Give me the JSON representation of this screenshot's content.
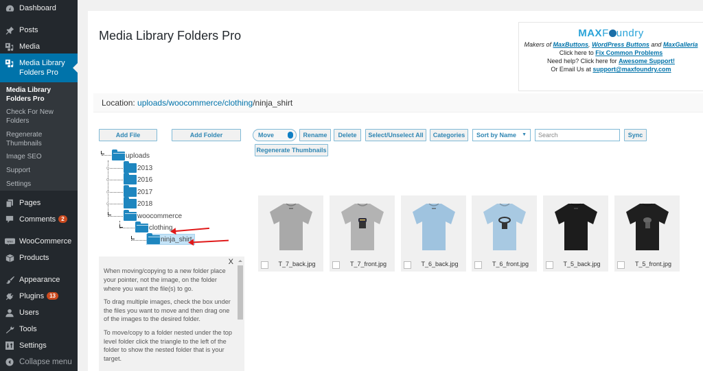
{
  "sidebar": {
    "items": [
      {
        "label": "Dashboard",
        "icon": "dashboard-icon"
      },
      {
        "label": "Posts",
        "icon": "pin-icon"
      },
      {
        "label": "Media",
        "icon": "media-icon"
      },
      {
        "label": "Media Library Folders Pro",
        "icon": "media-icon",
        "current": true
      },
      {
        "label": "Pages",
        "icon": "pages-icon"
      },
      {
        "label": "Comments",
        "icon": "comment-icon",
        "badge": "2"
      },
      {
        "label": "WooCommerce",
        "icon": "woo-icon"
      },
      {
        "label": "Products",
        "icon": "box-icon"
      },
      {
        "label": "Appearance",
        "icon": "brush-icon"
      },
      {
        "label": "Plugins",
        "icon": "plug-icon",
        "badge": "13"
      },
      {
        "label": "Users",
        "icon": "user-icon"
      },
      {
        "label": "Tools",
        "icon": "wrench-icon"
      },
      {
        "label": "Settings",
        "icon": "settings-icon"
      },
      {
        "label": "Collapse menu",
        "icon": "collapse-icon"
      }
    ],
    "submenu": [
      {
        "label": "Media Library Folders Pro",
        "current": true
      },
      {
        "label": "Check For New Folders"
      },
      {
        "label": "Regenerate Thumbnails"
      },
      {
        "label": "Image SEO"
      },
      {
        "label": "Support"
      },
      {
        "label": "Settings"
      }
    ]
  },
  "header": {
    "title": "Media Library Folders Pro"
  },
  "promo": {
    "logo_max": "MAX",
    "logo_f": "F",
    "logo_rest": "undry",
    "makers_prefix": "Makers of ",
    "link_maxbuttons": "MaxButtons",
    "comma": ", ",
    "link_wpbuttons": "WordPress Buttons",
    "and": " and ",
    "link_maxgalleria": "MaxGalleria",
    "fix_prefix": "Click here to ",
    "link_fix": "Fix Common Problems",
    "help_prefix": "Need help? Click here for ",
    "link_support": "Awesome Support!",
    "email_prefix": "Or Email Us at ",
    "link_email": "support@maxfoundry.com"
  },
  "location": {
    "label": "Location: ",
    "path_links": [
      "uploads",
      "woocommerce",
      "clothing"
    ],
    "sep": "/",
    "current": "ninja_shirt"
  },
  "toolbar": {
    "add_file": "Add File",
    "add_folder": "Add Folder",
    "move": "Move",
    "rename": "Rename",
    "delete": "Delete",
    "select_all": "Select/Unselect All",
    "categories": "Categories",
    "sort_selected": "Sort by Name",
    "search_placeholder": "Search",
    "sync": "Sync",
    "regenerate": "Regenerate Thumbnails"
  },
  "tree": {
    "root": "uploads",
    "years": [
      "2013",
      "2016",
      "2017",
      "2018"
    ],
    "woocommerce": "woocommerce",
    "clothing": "clothing",
    "selected": "ninja_shirt"
  },
  "help": {
    "close": "X",
    "paragraphs": [
      "When moving/copying to a new folder place your pointer, not the image, on the folder where you want the file(s) to go.",
      "To drag multiple images, check the box under the files you want to move and then drag one of the images to the desired folder.",
      "To move/copy to a folder nested under the top level folder click the triangle to the left of the folder to show the nested folder that is your target."
    ]
  },
  "files": [
    {
      "name": "T_7_back.jpg",
      "color": "#a9a9a9",
      "print": "none"
    },
    {
      "name": "T_7_front.jpg",
      "color": "#b3b3b3",
      "print": "ninja"
    },
    {
      "name": "T_6_back.jpg",
      "color": "#9fc3df",
      "print": "none"
    },
    {
      "name": "T_6_front.jpg",
      "color": "#a8c9e2",
      "print": "ninja-dark"
    },
    {
      "name": "T_5_back.jpg",
      "color": "#1c1c1c",
      "print": "none"
    },
    {
      "name": "T_5_front.jpg",
      "color": "#1f1f1f",
      "print": "ninja-grey"
    }
  ]
}
